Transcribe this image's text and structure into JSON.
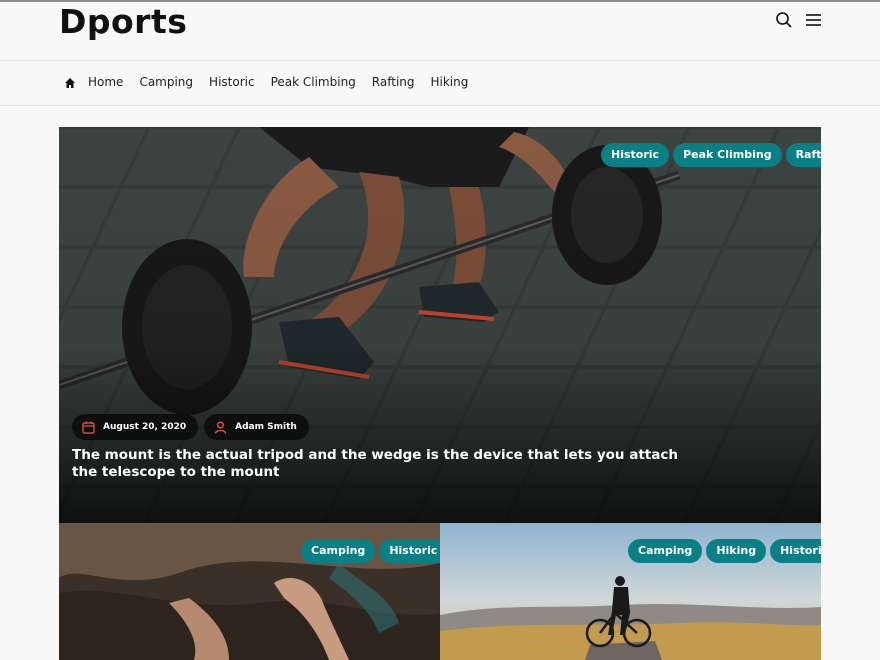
{
  "site": {
    "logo": "Dports"
  },
  "nav": {
    "items": [
      "Home",
      "Camping",
      "Historic",
      "Peak Climbing",
      "Rafting",
      "Hiking"
    ]
  },
  "hero": {
    "tags": [
      "Historic",
      "Peak Climbing",
      "Rafting"
    ],
    "date": "August 20, 2020",
    "author": "Adam Smith",
    "title": "The mount is the actual tripod and the wedge is the device that lets you attach the telescope to the mount"
  },
  "cards": [
    {
      "tags": [
        "Camping",
        "Historic"
      ]
    },
    {
      "tags": [
        "Camping",
        "Hiking",
        "Historic"
      ]
    }
  ],
  "colors": {
    "accent": "#0b7f86",
    "text": "#111111",
    "background": "#f8f8f8"
  },
  "icons": {
    "search": "search-icon",
    "menu": "hamburger-menu-icon",
    "home": "home-icon",
    "calendar": "calendar-icon",
    "user": "user-icon"
  }
}
